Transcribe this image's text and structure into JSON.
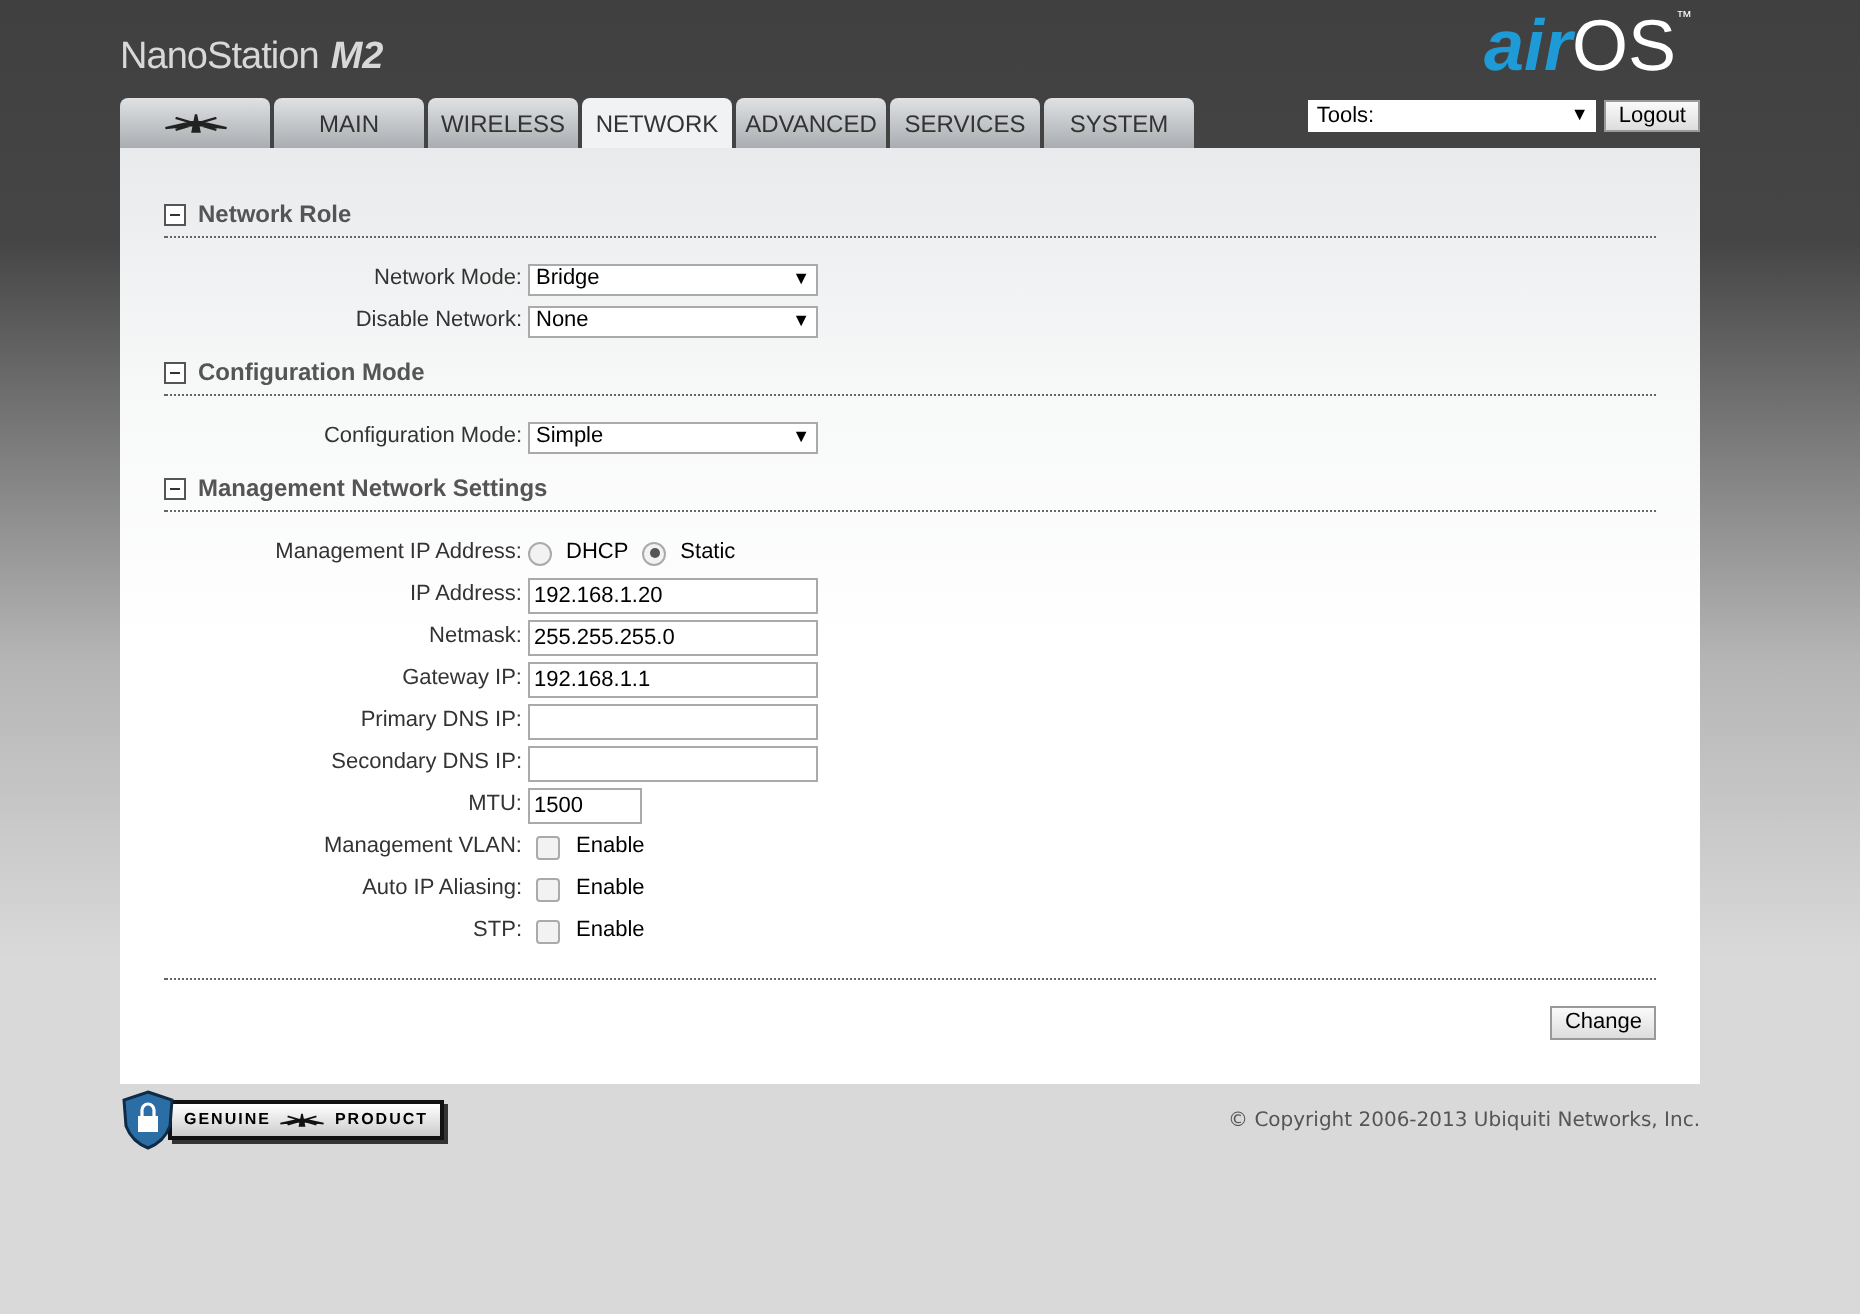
{
  "header": {
    "product": "NanoStation",
    "model": "M2",
    "logo_air": "air",
    "logo_os": "OS",
    "logo_tm": "™"
  },
  "tabs": [
    {
      "kind": "logo",
      "selected": false
    },
    {
      "kind": "text",
      "label": "MAIN",
      "selected": false
    },
    {
      "kind": "text",
      "label": "WIRELESS",
      "selected": false
    },
    {
      "kind": "text",
      "label": "NETWORK",
      "selected": true
    },
    {
      "kind": "text",
      "label": "ADVANCED",
      "selected": false
    },
    {
      "kind": "text",
      "label": "SERVICES",
      "selected": false
    },
    {
      "kind": "text",
      "label": "SYSTEM",
      "selected": false
    }
  ],
  "tools": {
    "value": "Tools:",
    "arrow": "▼"
  },
  "logout": "Logout",
  "sections": [
    {
      "title": "Network Role",
      "expanded": true,
      "rows": [
        {
          "kind": "select",
          "label": "Network Mode:",
          "value": "Bridge",
          "arrow": "▼"
        },
        {
          "kind": "select",
          "label": "Disable Network:",
          "value": "None",
          "arrow": "▼"
        }
      ]
    },
    {
      "title": "Configuration Mode",
      "expanded": true,
      "rows": [
        {
          "kind": "select",
          "label": "Configuration Mode:",
          "value": "Simple",
          "arrow": "▼"
        }
      ]
    },
    {
      "title": "Management Network Settings",
      "expanded": true,
      "rows": [
        {
          "kind": "radio",
          "label": "Management IP Address:",
          "options": [
            {
              "label": "DHCP",
              "selected": false
            },
            {
              "label": "Static",
              "selected": true
            }
          ]
        },
        {
          "kind": "text",
          "label": "IP Address:",
          "value": "192.168.1.20"
        },
        {
          "kind": "text",
          "label": "Netmask:",
          "value": "255.255.255.0"
        },
        {
          "kind": "text",
          "label": "Gateway IP:",
          "value": "192.168.1.1"
        },
        {
          "kind": "text",
          "label": "Primary DNS IP:"
        },
        {
          "kind": "text",
          "label": "Secondary DNS IP:"
        },
        {
          "kind": "short",
          "label": "MTU:",
          "value": "1500"
        },
        {
          "kind": "checkbox",
          "label": "Management VLAN:",
          "option": "Enable",
          "checked": false
        },
        {
          "kind": "checkbox",
          "label": "Auto IP Aliasing:",
          "option": "Enable",
          "checked": false
        },
        {
          "kind": "checkbox",
          "label": "STP:",
          "option": "Enable",
          "checked": false
        }
      ]
    }
  ],
  "change": "Change",
  "badge": {
    "left": "GENUINE",
    "right": "PRODUCT"
  },
  "copyright": "© Copyright 2006-2013 Ubiquiti Networks, Inc."
}
